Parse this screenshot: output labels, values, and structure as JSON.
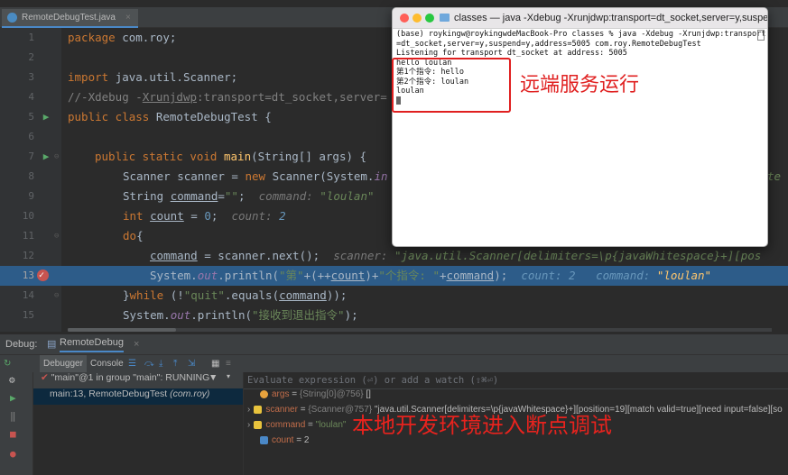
{
  "editor": {
    "tab_label": "RemoteDebugTest.java",
    "lines": [
      {
        "n": "1"
      },
      {
        "n": "2"
      },
      {
        "n": "3"
      },
      {
        "n": "4"
      },
      {
        "n": "5"
      },
      {
        "n": "6"
      },
      {
        "n": "7"
      },
      {
        "n": "8"
      },
      {
        "n": "9"
      },
      {
        "n": "10"
      },
      {
        "n": "11"
      },
      {
        "n": "12"
      },
      {
        "n": "13"
      },
      {
        "n": "14"
      },
      {
        "n": "15"
      }
    ],
    "code": {
      "l1_kw": "package ",
      "l1_rest": "com.roy;",
      "l3_kw": "import ",
      "l3_rest": "java.util.Scanner;",
      "l4_a": "//-Xdebug -",
      "l4_b": "Xrunjdwp",
      "l4_c": ":transport=dt_socket,server=",
      "l5_kw": "public class ",
      "l5_rest": "RemoteDebugTest {",
      "l7_kw": "public static void ",
      "l7_fn": "main",
      "l7_rest": "(String[] args) {",
      "l8_a": "Scanner scanner = ",
      "l8_kw": "new ",
      "l8_b": "Scanner(System.",
      "l8_fld": "in",
      "l9_a": "String ",
      "l9_var": "command",
      "l9_b": "=",
      "l9_str": "\"\"",
      "l9_c": ";",
      "l9_inl": "command: ",
      "l9_inlv": "\"loulan\"",
      "l10_kw": "int ",
      "l10_var": "count",
      "l10_b": " = ",
      "l10_num": "0",
      "l10_c": ";",
      "l10_inl": "count: ",
      "l10_inlv": "2",
      "l11_kw": "do",
      "l11_b": "{",
      "l12_var": "command",
      "l12_b": " = scanner.next();",
      "l12_inl": "scanner: ",
      "l12_inlv": "\"java.util.Scanner[delimiters=\\p{javaWhitespace}+][pos",
      "l13_a": "System.",
      "l13_fld": "out",
      "l13_b": ".println(",
      "l13_s1": "\"第\"",
      "l13_c": "+(++",
      "l13_var": "count",
      "l13_d": ")+",
      "l13_s2": "\"个指令: \"",
      "l13_e": "+",
      "l13_var2": "command",
      "l13_f": ");",
      "l13_inl1": "count: 2",
      "l13_inl2": "command: ",
      "l13_inlv2": "\"loulan\"",
      "l14_a": "}",
      "l14_kw": "while ",
      "l14_b": "(!",
      "l14_str": "\"quit\"",
      "l14_c": ".equals(",
      "l14_var": "command",
      "l14_d": "));",
      "l15_a": "System.",
      "l15_fld": "out",
      "l15_b": ".println(",
      "l15_str": "\"接收到退出指令\"",
      "l15_c": ");",
      "l8_right": "te"
    }
  },
  "debug": {
    "label": "Debug:",
    "config": "RemoteDebug",
    "tab_debugger": "Debugger",
    "tab_console": "Console",
    "thread": "\"main\"@1 in group \"main\": RUNNING",
    "frame_a": "main:13, RemoteDebugTest ",
    "frame_b": "(com.roy)",
    "eval_placeholder": "Evaluate expression (⏎) or add a watch (⇧⌘⏎)",
    "vars": [
      {
        "name": "args",
        "eq": " = ",
        "ref": "{String[0]@756}",
        "val": " []"
      },
      {
        "name": "scanner",
        "eq": " = ",
        "ref": "{Scanner@757}",
        "val": " \"java.util.Scanner[delimiters=\\p{javaWhitespace}+][position=19][match valid=true][need input=false][so"
      },
      {
        "name": "command",
        "eq": " = ",
        "ref": "",
        "val": "\"loulan\""
      },
      {
        "name": "count",
        "eq": " = ",
        "ref": "",
        "val": "2"
      }
    ]
  },
  "terminal": {
    "title": "classes — java -Xdebug -Xrunjdwp:transport=dt_socket,server=y,suspend=...",
    "lines": [
      "(base) roykingw@roykingwdeMacBook-Pro classes % java -Xdebug -Xrunjdwp:transport",
      "=dt_socket,server=y,suspend=y,address=5005 com.roy.RemoteDebugTest",
      "Listening for transport dt_socket at address: 5005",
      "hello loulan",
      "第1个指令: hello",
      "第2个指令: loulan",
      "loulan"
    ]
  },
  "annotations": {
    "remote": "远端服务运行",
    "local": "本地开发环境进入断点调试"
  },
  "colors": {
    "highlight": "#2d5c89",
    "breakpoint": "#c75450",
    "annotation": "#e02020"
  }
}
